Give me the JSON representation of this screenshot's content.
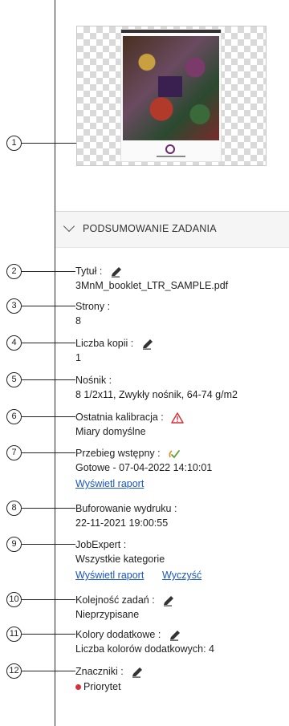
{
  "section": {
    "title": "PODSUMOWANIE ZADANIA"
  },
  "callouts": [
    "1",
    "2",
    "3",
    "4",
    "5",
    "6",
    "7",
    "8",
    "9",
    "10",
    "11",
    "12"
  ],
  "fields": {
    "title": {
      "label": "Tytuł :",
      "value": "3MnM_booklet_LTR_SAMPLE.pdf"
    },
    "pages": {
      "label": "Strony :",
      "value": "8"
    },
    "copies": {
      "label": "Liczba kopii :",
      "value": "1"
    },
    "media": {
      "label": "Nośnik :",
      "value": "8 1/2x11, Zwykły nośnik, 64-74 g/m2"
    },
    "calibration": {
      "label": "Ostatnia kalibracja :",
      "value": "Miary domyślne"
    },
    "preflight": {
      "label": "Przebieg wstępny :",
      "value": "Gotowe - 07-04-2022 14:10:01",
      "link": "Wyświetl raport"
    },
    "spooling": {
      "label": "Buforowanie wydruku :",
      "value": "22-11-2021 19:00:55"
    },
    "jobexpert": {
      "label": "JobExpert :",
      "value": "Wszystkie kategorie",
      "link_report": "Wyświetl raport",
      "link_clear": "Wyczyść"
    },
    "order": {
      "label": "Kolejność zadań :",
      "value": "Nieprzypisane"
    },
    "spot": {
      "label": "Kolory dodatkowe :",
      "value": "Liczba kolorów dodatkowych: 4"
    },
    "tags": {
      "label": "Znaczniki :",
      "value": "Priorytet"
    }
  },
  "icons": {
    "edit": "pencil-icon",
    "warning": "warning-triangle-icon",
    "preflight": "preflight-check-icon"
  },
  "colors": {
    "link": "#1a56c4",
    "warning": "#d6303a",
    "priority": "#d6303a",
    "preflight": "#e08a1e"
  }
}
